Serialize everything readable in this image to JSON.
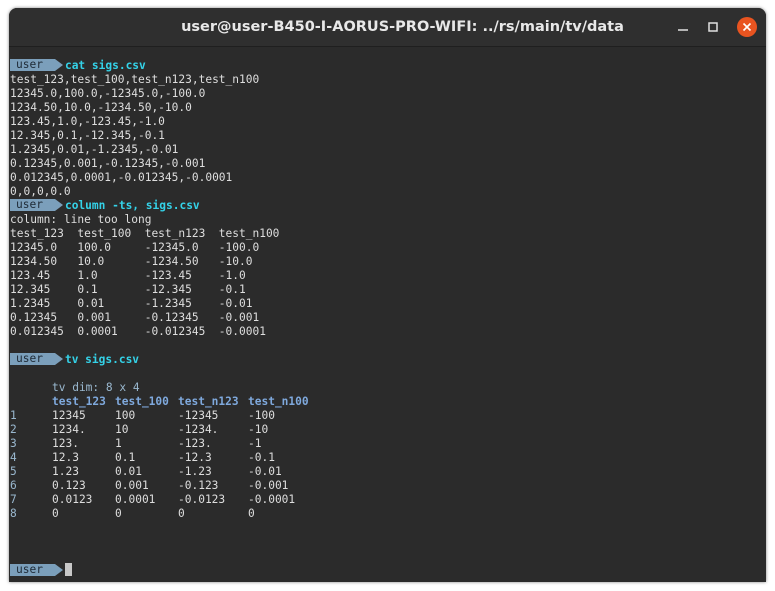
{
  "window": {
    "title": "user@user-B450-I-AORUS-PRO-WIFI: ../rs/main/tv/data"
  },
  "prompt": "user",
  "cmd1": "cat sigs.csv",
  "csv_lines": [
    "test_123,test_100,test_n123,test_n100",
    "12345.0,100.0,-12345.0,-100.0",
    "1234.50,10.0,-1234.50,-10.0",
    "123.45,1.0,-123.45,-1.0",
    "12.345,0.1,-12.345,-0.1",
    "1.2345,0.01,-1.2345,-0.01",
    "0.12345,0.001,-0.12345,-0.001",
    "0.012345,0.0001,-0.012345,-0.0001",
    "0,0,0,0.0"
  ],
  "cmd2": "column -ts, sigs.csv",
  "column_warning": "column: line too long",
  "column_lines": [
    "test_123  test_100  test_n123  test_n100",
    "12345.0   100.0     -12345.0   -100.0",
    "1234.50   10.0      -1234.50   -10.0",
    "123.45    1.0       -123.45    -1.0",
    "12.345    0.1       -12.345    -0.1",
    "1.2345    0.01      -1.2345    -0.01",
    "0.12345   0.001     -0.12345   -0.001",
    "0.012345  0.0001    -0.012345  -0.0001"
  ],
  "cmd3": "tv sigs.csv",
  "tv": {
    "dim": "tv dim: 8 x 4",
    "headers": [
      "test_123",
      "test_100",
      "test_n123",
      "test_n100"
    ],
    "rows": [
      [
        "1",
        "12345",
        "100",
        "-12345",
        "-100"
      ],
      [
        "2",
        "1234.",
        "10",
        "-1234.",
        "-10"
      ],
      [
        "3",
        "123.",
        "1",
        "-123.",
        "-1"
      ],
      [
        "4",
        "12.3",
        "0.1",
        "-12.3",
        "-0.1"
      ],
      [
        "5",
        "1.23",
        "0.01",
        "-1.23",
        "-0.01"
      ],
      [
        "6",
        "0.123",
        "0.001",
        "-0.123",
        "-0.001"
      ],
      [
        "7",
        "0.0123",
        "0.0001",
        "-0.0123",
        "-0.0001"
      ],
      [
        "8",
        "0",
        "0",
        "0",
        "0"
      ]
    ]
  },
  "colors": {
    "accent": "#34d2e8",
    "prompt_bg": "#7b9fbb",
    "tv_header": "#7fa9dd",
    "close": "#e95420"
  }
}
